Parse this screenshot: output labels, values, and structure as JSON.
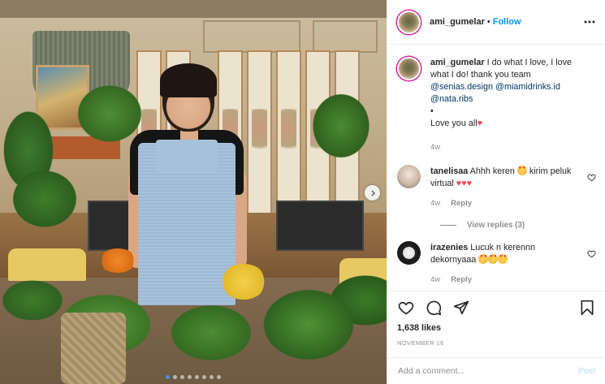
{
  "post": {
    "author": "ami_gumelar",
    "separator": "•",
    "follow_label": "Follow",
    "caption_parts": {
      "text1": "I do what I love, I love what I do! thank you team ",
      "mention1": "@senias.design",
      "mention2": "@miamidrinks.id",
      "mention3": "@nata.ribs",
      "bullet": "•",
      "closing": "Love you all"
    },
    "caption_age": "4w",
    "likes": "1,638 likes",
    "date": "NOVEMBER 16"
  },
  "comments": [
    {
      "username": "tanelisaa",
      "text_a": "Ahhh keren",
      "text_b": "kirim peluk virtual",
      "age": "4w",
      "reply_label": "Reply",
      "view_replies": "View replies (3)"
    },
    {
      "username": "irazenies",
      "text_a": "Lucuk n kerennn dekornyaaa",
      "age": "4w",
      "reply_label": "Reply"
    }
  ],
  "add_comment": {
    "placeholder": "Add a comment...",
    "post_label": "Post"
  },
  "carousel": {
    "slides": 8,
    "active_index": 0
  },
  "colors": {
    "accent": "#0095f6",
    "heart": "#ed4956",
    "muted": "#8e8e8e"
  },
  "icons": [
    "more-options-icon",
    "like-icon",
    "comment-icon",
    "share-icon",
    "save-icon",
    "next-arrow-icon",
    "comment-like-icon"
  ]
}
